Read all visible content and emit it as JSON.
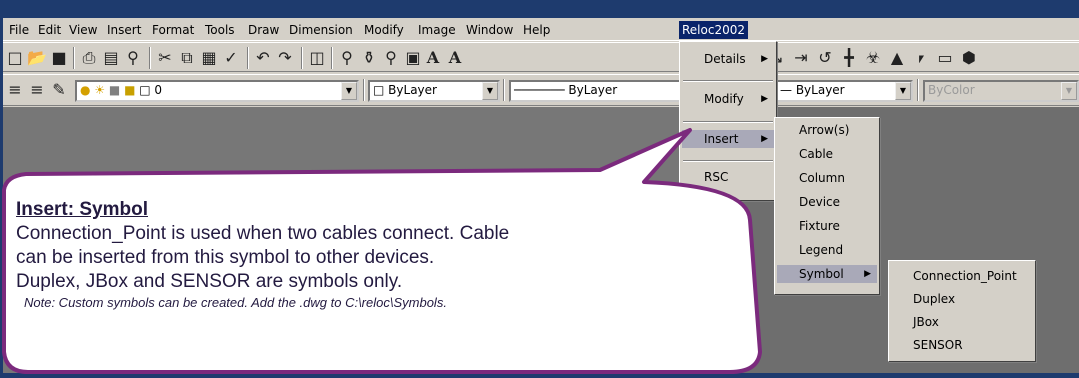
{
  "menubar": {
    "items": [
      "File",
      "Edit",
      "View",
      "Insert",
      "Format",
      "Tools",
      "Draw",
      "Dimension",
      "Modify",
      "Image",
      "Window",
      "Help",
      "Reloc2002"
    ]
  },
  "toolbar": {
    "layer_value": "0",
    "color_value": "ByLayer",
    "linetype_value": "ByLayer",
    "lineweight_value": "ByLayer",
    "plotstyle_value": "ByColor"
  },
  "reloc_menu": {
    "items": [
      {
        "label": "Details",
        "submenu": true
      },
      {
        "label": "Modify",
        "submenu": true
      },
      {
        "label": "Insert",
        "submenu": true
      },
      {
        "label": "RSC",
        "submenu": false
      }
    ]
  },
  "insert_menu": {
    "items": [
      "Arrow(s)",
      "Cable",
      "Column",
      "Device",
      "Fixture",
      "Legend",
      "Symbol"
    ]
  },
  "symbol_menu": {
    "items": [
      "Connection_Point",
      "Duplex",
      "JBox",
      "SENSOR"
    ]
  },
  "callout": {
    "title": "Insert: Symbol",
    "line1": "Connection_Point is used when two cables connect. Cable",
    "line2": "can be inserted from this symbol to other devices.",
    "line3": "Duplex, JBox and SENSOR are symbols only.",
    "note": "Note: Custom symbols can be created. Add the .dwg to C:\\reloc\\Symbols."
  },
  "colors": {
    "frame": "#1e3b6e",
    "callout_border": "#7b2a7d",
    "callout_fill": "#ffffff",
    "menu_highlight": "#0a246a"
  },
  "icons": [
    "new-icon",
    "open-icon",
    "save-icon",
    "print-icon",
    "preview-icon",
    "spell-icon",
    "cut-icon",
    "copy-icon",
    "paste-icon",
    "match-icon",
    "undo-icon",
    "redo-icon",
    "pan-icon",
    "zoom-realtime-icon",
    "zoom-window-icon",
    "zoom-prev-icon",
    "text-icon",
    "bulb-icon",
    "sun-icon",
    "lock-icon",
    "submenu-arrow-icon"
  ]
}
